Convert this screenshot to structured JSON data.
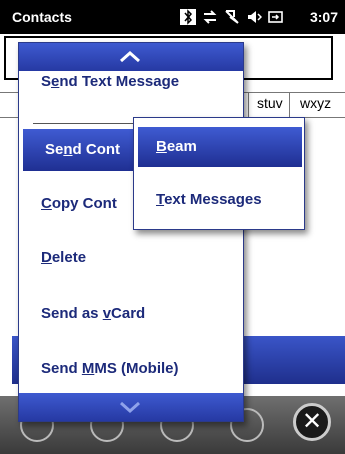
{
  "statusbar": {
    "title": "Contacts",
    "time": "3:07",
    "icons": [
      "bluetooth-icon",
      "sync-icon",
      "signal-icon",
      "volume-icon",
      "battery-icon"
    ]
  },
  "contacts_list": {
    "alpha_tabs": [
      "stuv",
      "wxyz"
    ]
  },
  "context_menu": {
    "items": [
      {
        "name": "send-text-message",
        "label": "Send Text Message",
        "mnemonic_index": 1
      },
      {
        "name": "send-contact",
        "label": "Send Cont",
        "mnemonic_index": 2
      },
      {
        "name": "copy-contact",
        "label": "Copy Cont",
        "mnemonic_index": 0
      },
      {
        "name": "delete",
        "label": "Delete",
        "mnemonic_index": 0
      },
      {
        "name": "send-as-vcard",
        "label": "Send as vCard",
        "mnemonic_index": 8
      },
      {
        "name": "send-mms",
        "label": "Send MMS (Mobile)",
        "mnemonic_index": 5
      }
    ]
  },
  "submenu": {
    "items": [
      {
        "name": "beam",
        "label": "Beam",
        "mnemonic_index": 0
      },
      {
        "name": "text-messages",
        "label": "Text Messages",
        "mnemonic_index": 0
      }
    ]
  },
  "taskbar": {
    "close_glyph": "✕"
  }
}
